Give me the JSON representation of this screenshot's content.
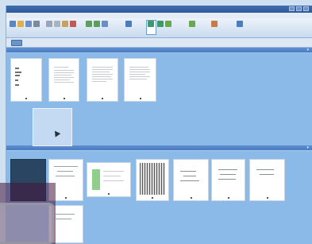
{
  "window": {
    "title": ""
  },
  "menu": {
    "items": [
      "",
      "",
      "",
      "",
      "",
      "",
      "",
      "",
      ""
    ]
  },
  "toolbar": {
    "tools": [
      {
        "icon": "new-icon",
        "color": "#5a86c4"
      },
      {
        "icon": "open-icon",
        "color": "#e0b04a"
      },
      {
        "icon": "save-icon",
        "color": "#6a8fc4"
      },
      {
        "icon": "print-icon",
        "color": "#7c8aa0"
      },
      {
        "icon": "cut-icon",
        "color": "#9aa6b6"
      },
      {
        "icon": "copy-icon",
        "color": "#a8b4c4"
      },
      {
        "icon": "paste-icon",
        "color": "#c8a060"
      },
      {
        "icon": "delete-icon",
        "color": "#c05a5a"
      },
      {
        "icon": "rotate-left-icon",
        "color": "#5d9e5d"
      },
      {
        "icon": "rotate-right-icon",
        "color": "#5d9e5d"
      },
      {
        "icon": "zoom-icon",
        "color": "#6a8fc4"
      },
      {
        "icon": "select-icon",
        "color": "#4a7cc0"
      },
      {
        "icon": "extract-icon",
        "color": "#3f9a6a"
      },
      {
        "icon": "insert-icon",
        "color": "#3f9a6a"
      },
      {
        "icon": "split-icon",
        "color": "#6aa84f"
      },
      {
        "icon": "merge-icon",
        "color": "#6aa84f"
      },
      {
        "icon": "export-icon",
        "color": "#c87a4a"
      },
      {
        "icon": "help-icon",
        "color": "#4a7cc0"
      }
    ]
  },
  "panels": {
    "top": {
      "title": ""
    },
    "bottom": {
      "title": ""
    }
  },
  "colors": {
    "panel_bg": "#8bbae8",
    "header": "#4a7cc0",
    "toolbar": "#dde8f4"
  }
}
